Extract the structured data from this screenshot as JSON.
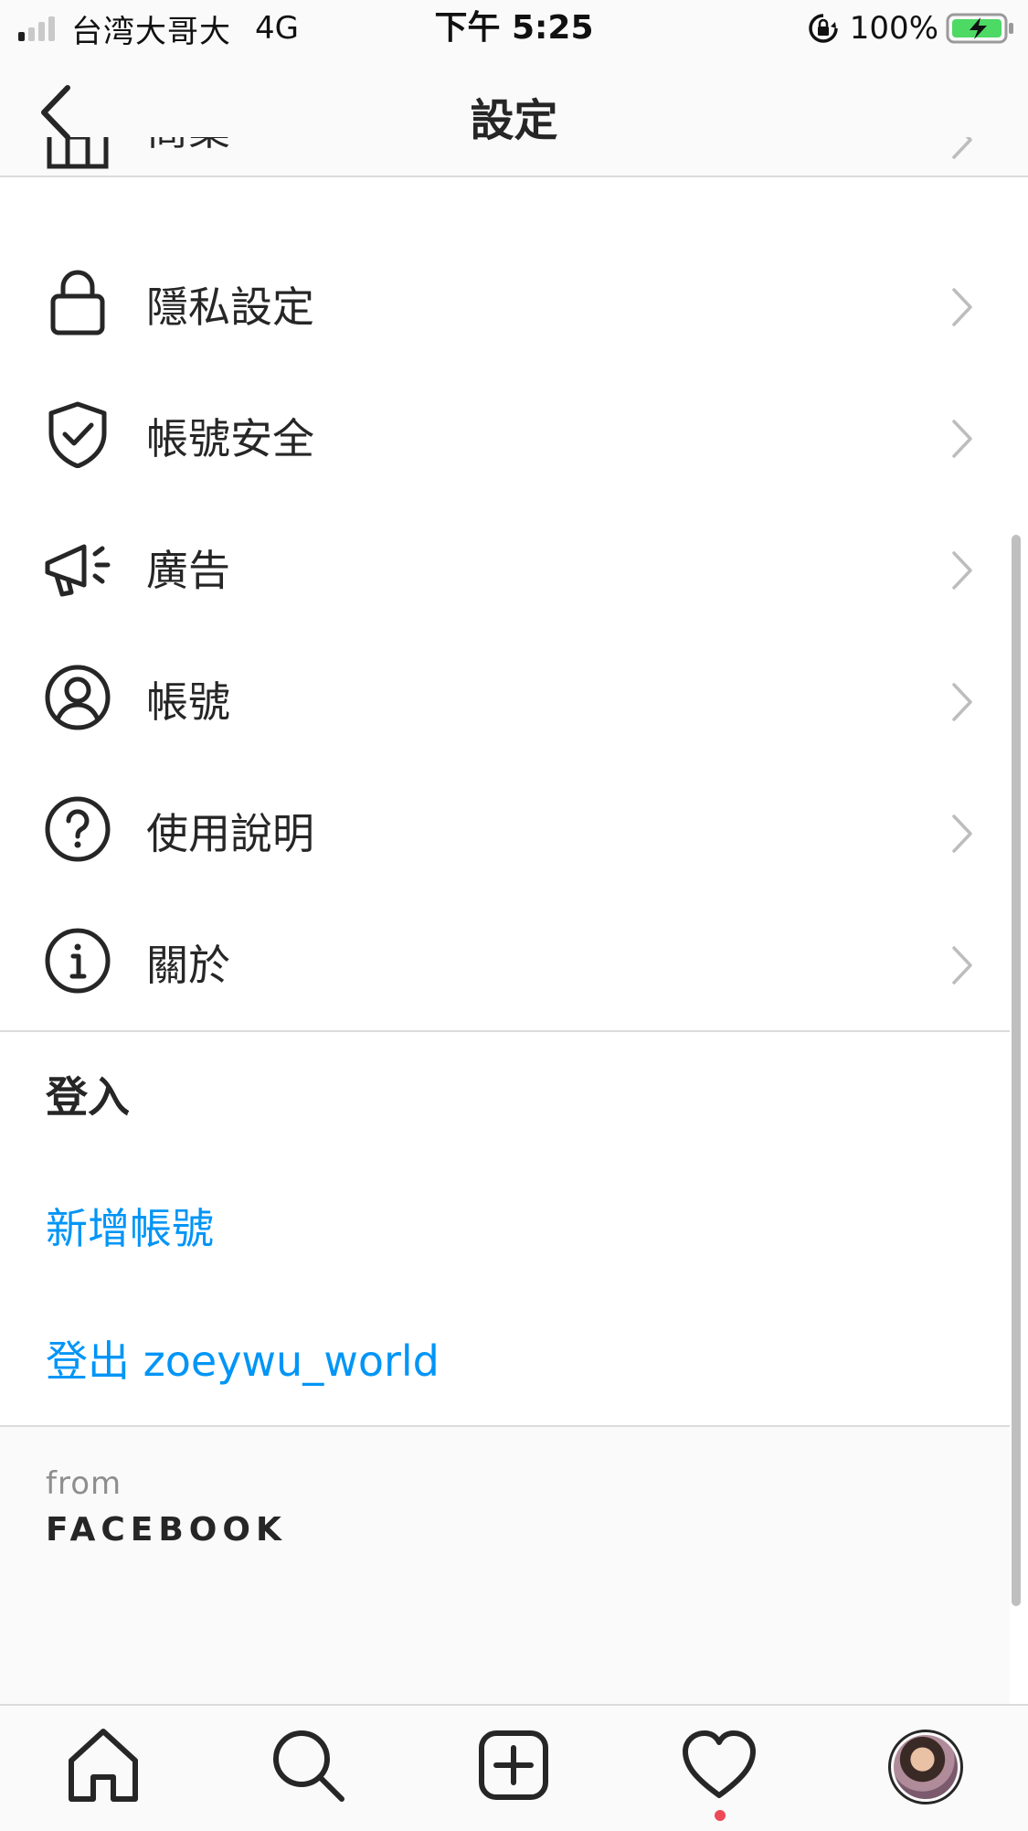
{
  "status_bar": {
    "carrier": "台湾大哥大",
    "network": "4G",
    "time": "下午 5:25",
    "battery": "100%"
  },
  "header": {
    "title": "設定"
  },
  "menu": {
    "partial_label": "商業",
    "items": [
      {
        "label": "隱私設定",
        "icon": "lock-icon"
      },
      {
        "label": "帳號安全",
        "icon": "shield-check-icon"
      },
      {
        "label": "廣告",
        "icon": "megaphone-icon"
      },
      {
        "label": "帳號",
        "icon": "user-circle-icon"
      },
      {
        "label": "使用說明",
        "icon": "help-circle-icon"
      },
      {
        "label": "關於",
        "icon": "info-circle-icon"
      }
    ]
  },
  "login_section": {
    "title": "登入",
    "add_account": "新增帳號",
    "logout": "登出 zoeywu_world"
  },
  "footer": {
    "from": "from",
    "brand": "FACEBOOK"
  },
  "colors": {
    "link": "#0095f6",
    "text": "#262626",
    "notification": "#ed4956"
  }
}
